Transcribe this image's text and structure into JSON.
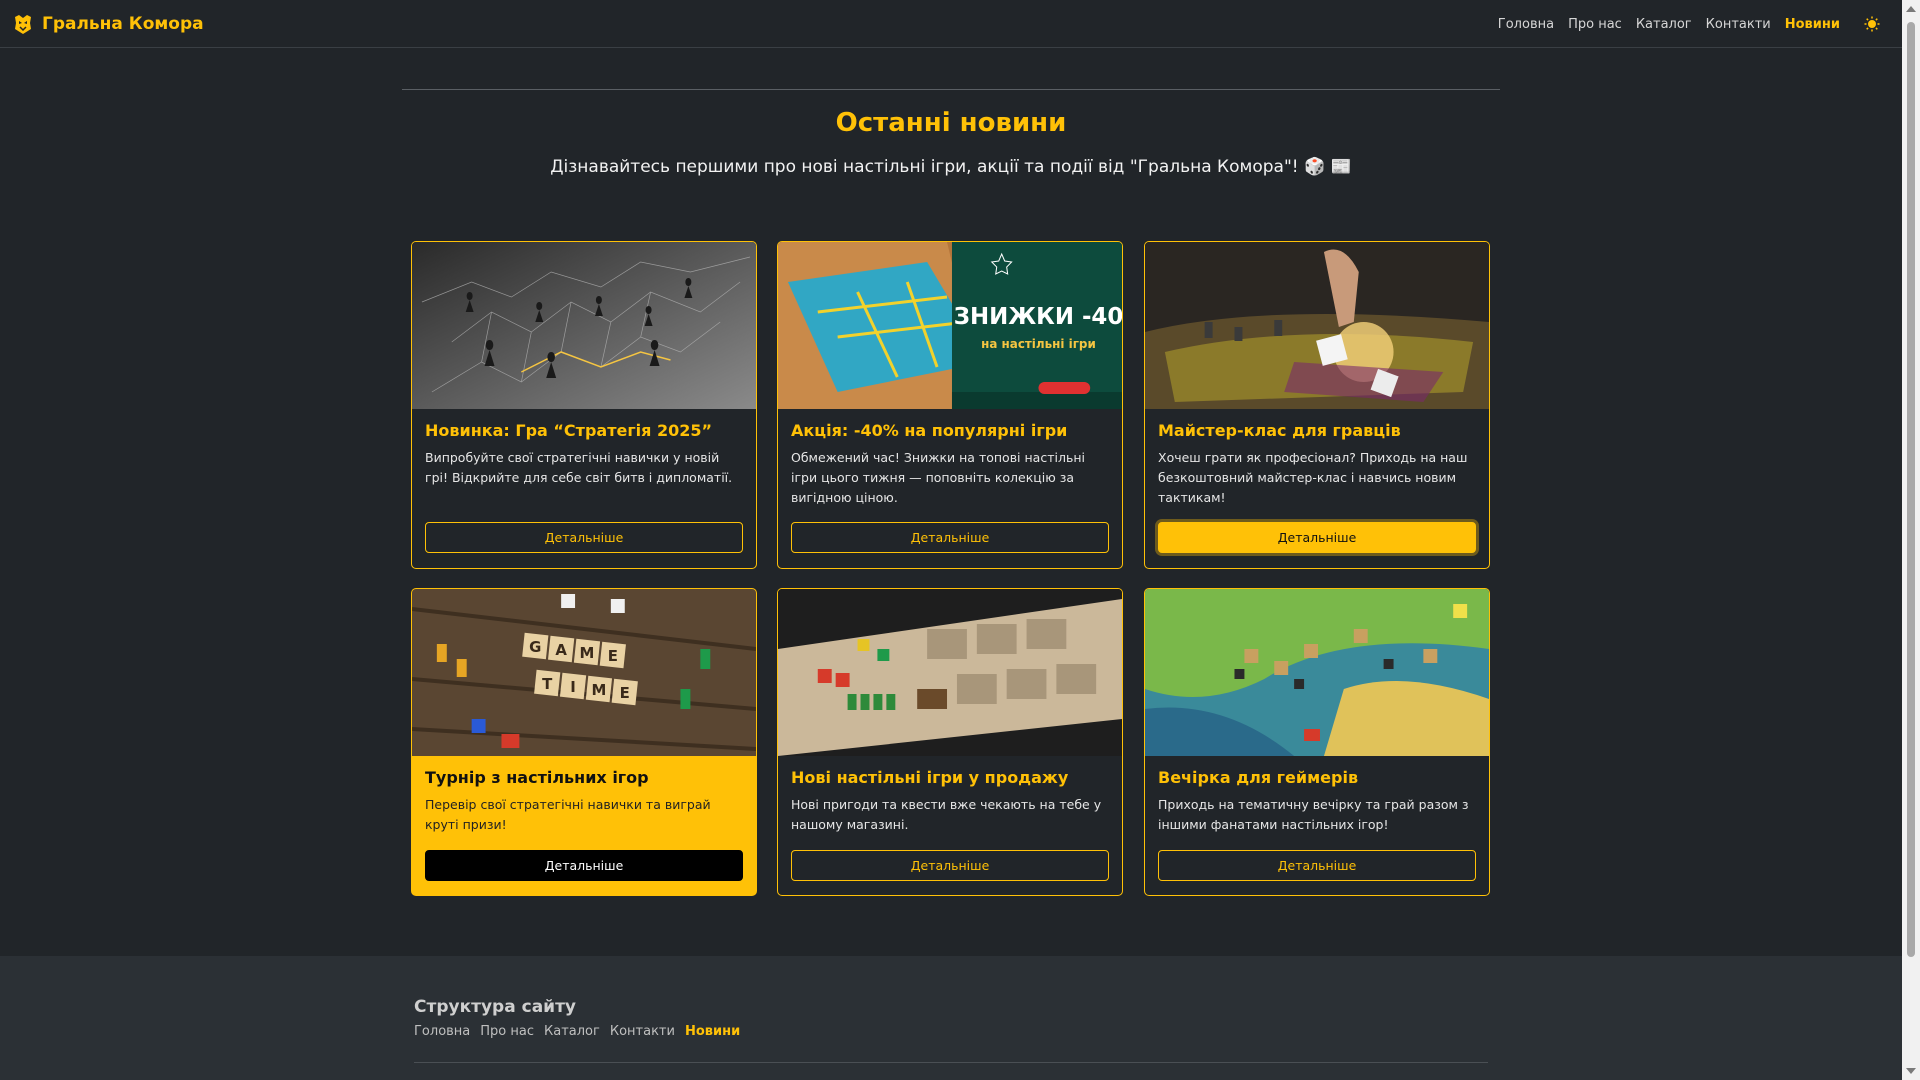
{
  "navbar": {
    "brand": "Гральна Комора",
    "links": [
      {
        "label": "Головна",
        "active": false
      },
      {
        "label": "Про нас",
        "active": false
      },
      {
        "label": "Каталог",
        "active": false
      },
      {
        "label": "Контакти",
        "active": false
      },
      {
        "label": "Новини",
        "active": true
      }
    ],
    "theme_icon": "sun-icon"
  },
  "header": {
    "title": "Останні новини",
    "subtitle": "Дізнавайтесь першими про нові настільні ігри, акції та події від \"Гральна Комора\"! 🎲 📰"
  },
  "cards": [
    {
      "title": "Новинка: Гра “Стратегія 2025”",
      "text": "Випробуйте свої стратегічні навички у новій грі! Відкрийте для себе світ битв і дипломатії.",
      "button": "Детальніше",
      "image": "chess-pieces-network-image"
    },
    {
      "title": "Акція: -40% на популярні ігри",
      "text": "Обмежений час! Знижки на топові настільні ігри цього тижня — поповніть колекцію за вигідною ціною.",
      "button": "Детальніше",
      "image": "discount-boardgame-banner-image",
      "image_text": "ЗНИЖКИ -40 на настільні ігри"
    },
    {
      "title": "Майстер-клас для гравців",
      "text": "Хочеш грати як професіонал? Приходь на наш безкоштовний майстер-клас і навчись новим тактикам!",
      "button": "Детальніше",
      "image": "miniatures-dice-game-image"
    },
    {
      "title": "Турнір з настільних ігор",
      "text": "Перевір свої стратегічні навички та виграй круті призи!",
      "button": "Детальніше",
      "image": "game-time-tiles-image",
      "image_text": "GAME TIME"
    },
    {
      "title": "Нові настільні ігри у продажу",
      "text": "Нові пригоди та квести вже чекають на тебе у нашому магазині.",
      "button": "Детальніше",
      "image": "boardgame-table-dice-image"
    },
    {
      "title": "Вечірка для геймерів",
      "text": "Приходь на тематичну вечірку та грай разом з іншими фанатами настільних ігор!",
      "button": "Детальніше",
      "image": "colorful-map-boardgame-image"
    }
  ],
  "footer": {
    "title": "Структура сайту",
    "links": [
      {
        "label": "Головна",
        "active": false
      },
      {
        "label": "Про нас",
        "active": false
      },
      {
        "label": "Каталог",
        "active": false
      },
      {
        "label": "Контакти",
        "active": false
      },
      {
        "label": "Новини",
        "active": true
      }
    ]
  },
  "colors": {
    "accent": "#ffc107",
    "background": "#212529",
    "footer": "#2b3035"
  }
}
